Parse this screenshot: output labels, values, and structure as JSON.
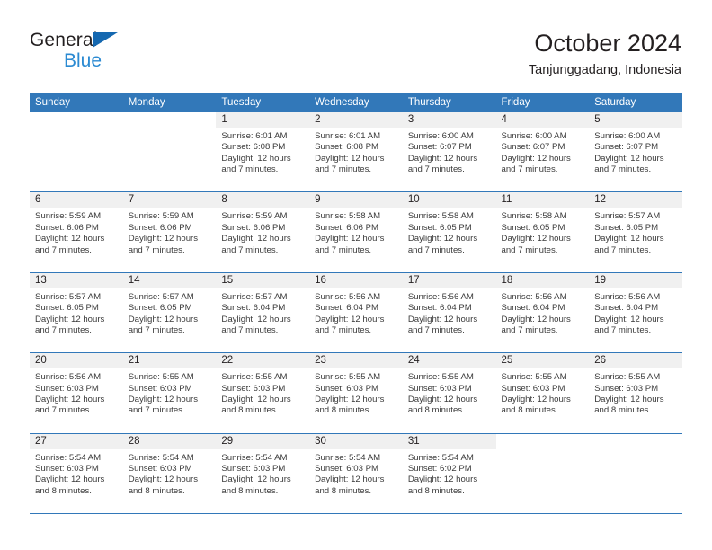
{
  "brand": {
    "line1": "General",
    "line2": "Blue",
    "triangle_color": "#1568b0",
    "line2_color": "#2b8ad2"
  },
  "header": {
    "title": "October 2024",
    "subtitle": "Tanjunggadang, Indonesia"
  },
  "colors": {
    "header_blue": "#3278b9",
    "daynum_band": "#f0f0f0",
    "text": "#231f20",
    "body_text": "#3a3a3a"
  },
  "weekdays": [
    "Sunday",
    "Monday",
    "Tuesday",
    "Wednesday",
    "Thursday",
    "Friday",
    "Saturday"
  ],
  "weeks": [
    [
      {
        "day": "",
        "sunrise": "",
        "sunset": "",
        "daylight1": "",
        "daylight2": ""
      },
      {
        "day": "",
        "sunrise": "",
        "sunset": "",
        "daylight1": "",
        "daylight2": ""
      },
      {
        "day": "1",
        "sunrise": "Sunrise: 6:01 AM",
        "sunset": "Sunset: 6:08 PM",
        "daylight1": "Daylight: 12 hours",
        "daylight2": "and 7 minutes."
      },
      {
        "day": "2",
        "sunrise": "Sunrise: 6:01 AM",
        "sunset": "Sunset: 6:08 PM",
        "daylight1": "Daylight: 12 hours",
        "daylight2": "and 7 minutes."
      },
      {
        "day": "3",
        "sunrise": "Sunrise: 6:00 AM",
        "sunset": "Sunset: 6:07 PM",
        "daylight1": "Daylight: 12 hours",
        "daylight2": "and 7 minutes."
      },
      {
        "day": "4",
        "sunrise": "Sunrise: 6:00 AM",
        "sunset": "Sunset: 6:07 PM",
        "daylight1": "Daylight: 12 hours",
        "daylight2": "and 7 minutes."
      },
      {
        "day": "5",
        "sunrise": "Sunrise: 6:00 AM",
        "sunset": "Sunset: 6:07 PM",
        "daylight1": "Daylight: 12 hours",
        "daylight2": "and 7 minutes."
      }
    ],
    [
      {
        "day": "6",
        "sunrise": "Sunrise: 5:59 AM",
        "sunset": "Sunset: 6:06 PM",
        "daylight1": "Daylight: 12 hours",
        "daylight2": "and 7 minutes."
      },
      {
        "day": "7",
        "sunrise": "Sunrise: 5:59 AM",
        "sunset": "Sunset: 6:06 PM",
        "daylight1": "Daylight: 12 hours",
        "daylight2": "and 7 minutes."
      },
      {
        "day": "8",
        "sunrise": "Sunrise: 5:59 AM",
        "sunset": "Sunset: 6:06 PM",
        "daylight1": "Daylight: 12 hours",
        "daylight2": "and 7 minutes."
      },
      {
        "day": "9",
        "sunrise": "Sunrise: 5:58 AM",
        "sunset": "Sunset: 6:06 PM",
        "daylight1": "Daylight: 12 hours",
        "daylight2": "and 7 minutes."
      },
      {
        "day": "10",
        "sunrise": "Sunrise: 5:58 AM",
        "sunset": "Sunset: 6:05 PM",
        "daylight1": "Daylight: 12 hours",
        "daylight2": "and 7 minutes."
      },
      {
        "day": "11",
        "sunrise": "Sunrise: 5:58 AM",
        "sunset": "Sunset: 6:05 PM",
        "daylight1": "Daylight: 12 hours",
        "daylight2": "and 7 minutes."
      },
      {
        "day": "12",
        "sunrise": "Sunrise: 5:57 AM",
        "sunset": "Sunset: 6:05 PM",
        "daylight1": "Daylight: 12 hours",
        "daylight2": "and 7 minutes."
      }
    ],
    [
      {
        "day": "13",
        "sunrise": "Sunrise: 5:57 AM",
        "sunset": "Sunset: 6:05 PM",
        "daylight1": "Daylight: 12 hours",
        "daylight2": "and 7 minutes."
      },
      {
        "day": "14",
        "sunrise": "Sunrise: 5:57 AM",
        "sunset": "Sunset: 6:05 PM",
        "daylight1": "Daylight: 12 hours",
        "daylight2": "and 7 minutes."
      },
      {
        "day": "15",
        "sunrise": "Sunrise: 5:57 AM",
        "sunset": "Sunset: 6:04 PM",
        "daylight1": "Daylight: 12 hours",
        "daylight2": "and 7 minutes."
      },
      {
        "day": "16",
        "sunrise": "Sunrise: 5:56 AM",
        "sunset": "Sunset: 6:04 PM",
        "daylight1": "Daylight: 12 hours",
        "daylight2": "and 7 minutes."
      },
      {
        "day": "17",
        "sunrise": "Sunrise: 5:56 AM",
        "sunset": "Sunset: 6:04 PM",
        "daylight1": "Daylight: 12 hours",
        "daylight2": "and 7 minutes."
      },
      {
        "day": "18",
        "sunrise": "Sunrise: 5:56 AM",
        "sunset": "Sunset: 6:04 PM",
        "daylight1": "Daylight: 12 hours",
        "daylight2": "and 7 minutes."
      },
      {
        "day": "19",
        "sunrise": "Sunrise: 5:56 AM",
        "sunset": "Sunset: 6:04 PM",
        "daylight1": "Daylight: 12 hours",
        "daylight2": "and 7 minutes."
      }
    ],
    [
      {
        "day": "20",
        "sunrise": "Sunrise: 5:56 AM",
        "sunset": "Sunset: 6:03 PM",
        "daylight1": "Daylight: 12 hours",
        "daylight2": "and 7 minutes."
      },
      {
        "day": "21",
        "sunrise": "Sunrise: 5:55 AM",
        "sunset": "Sunset: 6:03 PM",
        "daylight1": "Daylight: 12 hours",
        "daylight2": "and 7 minutes."
      },
      {
        "day": "22",
        "sunrise": "Sunrise: 5:55 AM",
        "sunset": "Sunset: 6:03 PM",
        "daylight1": "Daylight: 12 hours",
        "daylight2": "and 8 minutes."
      },
      {
        "day": "23",
        "sunrise": "Sunrise: 5:55 AM",
        "sunset": "Sunset: 6:03 PM",
        "daylight1": "Daylight: 12 hours",
        "daylight2": "and 8 minutes."
      },
      {
        "day": "24",
        "sunrise": "Sunrise: 5:55 AM",
        "sunset": "Sunset: 6:03 PM",
        "daylight1": "Daylight: 12 hours",
        "daylight2": "and 8 minutes."
      },
      {
        "day": "25",
        "sunrise": "Sunrise: 5:55 AM",
        "sunset": "Sunset: 6:03 PM",
        "daylight1": "Daylight: 12 hours",
        "daylight2": "and 8 minutes."
      },
      {
        "day": "26",
        "sunrise": "Sunrise: 5:55 AM",
        "sunset": "Sunset: 6:03 PM",
        "daylight1": "Daylight: 12 hours",
        "daylight2": "and 8 minutes."
      }
    ],
    [
      {
        "day": "27",
        "sunrise": "Sunrise: 5:54 AM",
        "sunset": "Sunset: 6:03 PM",
        "daylight1": "Daylight: 12 hours",
        "daylight2": "and 8 minutes."
      },
      {
        "day": "28",
        "sunrise": "Sunrise: 5:54 AM",
        "sunset": "Sunset: 6:03 PM",
        "daylight1": "Daylight: 12 hours",
        "daylight2": "and 8 minutes."
      },
      {
        "day": "29",
        "sunrise": "Sunrise: 5:54 AM",
        "sunset": "Sunset: 6:03 PM",
        "daylight1": "Daylight: 12 hours",
        "daylight2": "and 8 minutes."
      },
      {
        "day": "30",
        "sunrise": "Sunrise: 5:54 AM",
        "sunset": "Sunset: 6:03 PM",
        "daylight1": "Daylight: 12 hours",
        "daylight2": "and 8 minutes."
      },
      {
        "day": "31",
        "sunrise": "Sunrise: 5:54 AM",
        "sunset": "Sunset: 6:02 PM",
        "daylight1": "Daylight: 12 hours",
        "daylight2": "and 8 minutes."
      },
      {
        "day": "",
        "sunrise": "",
        "sunset": "",
        "daylight1": "",
        "daylight2": ""
      },
      {
        "day": "",
        "sunrise": "",
        "sunset": "",
        "daylight1": "",
        "daylight2": ""
      }
    ]
  ]
}
